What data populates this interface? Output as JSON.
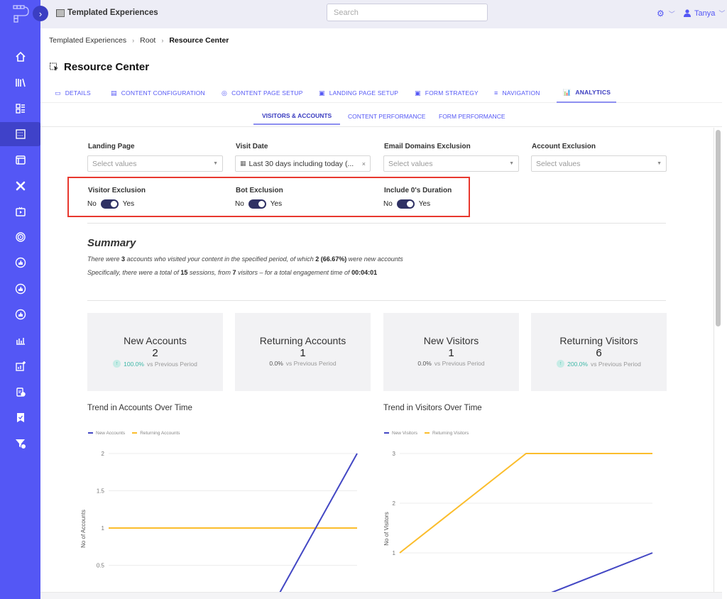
{
  "colors": {
    "accent": "#5457f5",
    "sidebar": "#5457f5",
    "toggle_on": "#2f3164",
    "highlight": "#e8382e",
    "series_blue": "#4347c4",
    "series_yellow": "#fbbd2c",
    "positive": "#3cb7a6"
  },
  "topbar": {
    "app_title": "Templated Experiences",
    "search_placeholder": "Search",
    "settings_icon": "gear-icon",
    "user_name": "Tanya"
  },
  "sidebar": {
    "items": [
      {
        "icon": "home-icon"
      },
      {
        "icon": "library-icon"
      },
      {
        "icon": "layout-grid-icon"
      },
      {
        "icon": "templated-experiences-icon",
        "active": true
      },
      {
        "icon": "browser-window-icon"
      },
      {
        "icon": "tools-icon"
      },
      {
        "icon": "video-icon"
      },
      {
        "icon": "target-icon"
      },
      {
        "icon": "thumbs-up-icon"
      },
      {
        "icon": "thumbs-up-icon"
      },
      {
        "icon": "thumbs-up-icon"
      },
      {
        "icon": "bar-chart-icon"
      },
      {
        "icon": "chart-add-icon"
      },
      {
        "icon": "clipboard-clock-icon"
      },
      {
        "icon": "bookmark-check-icon"
      },
      {
        "icon": "filter-dollar-icon"
      }
    ]
  },
  "breadcrumb": [
    "Templated Experiences",
    "Root",
    "Resource Center"
  ],
  "page_title": "Resource Center",
  "tabs": [
    {
      "label": "DETAILS",
      "icon": "image-icon"
    },
    {
      "label": "CONTENT CONFIGURATION",
      "icon": "document-icon"
    },
    {
      "label": "CONTENT PAGE SETUP",
      "icon": "palette-icon"
    },
    {
      "label": "LANDING PAGE SETUP",
      "icon": "page-icon"
    },
    {
      "label": "FORM STRATEGY",
      "icon": "form-icon"
    },
    {
      "label": "NAVIGATION",
      "icon": "menu-icon"
    },
    {
      "label": "ANALYTICS",
      "icon": "analytics-icon",
      "active": true
    }
  ],
  "subtabs": [
    {
      "label": "VISITORS & ACCOUNTS",
      "active": true
    },
    {
      "label": "CONTENT PERFORMANCE"
    },
    {
      "label": "FORM PERFORMANCE"
    }
  ],
  "filters": {
    "landing_page": {
      "label": "Landing Page",
      "placeholder": "Select values"
    },
    "visit_date": {
      "label": "Visit Date",
      "value": "Last 30 days including today (..."
    },
    "email_domains": {
      "label": "Email Domains Exclusion",
      "placeholder": "Select values"
    },
    "account_exclusion": {
      "label": "Account Exclusion",
      "placeholder": "Select values"
    }
  },
  "toggles": [
    {
      "label": "Visitor Exclusion",
      "off_label": "No",
      "on_label": "Yes",
      "value": true
    },
    {
      "label": "Bot Exclusion",
      "off_label": "No",
      "on_label": "Yes",
      "value": true
    },
    {
      "label": "Include 0's Duration",
      "off_label": "No",
      "on_label": "Yes",
      "value": true
    }
  ],
  "summary": {
    "title": "Summary",
    "line1": {
      "a": "There were ",
      "accounts": "3",
      "b": " accounts who visited your content in the specified period, of which ",
      "new": "2",
      "pct": " (66.67%)",
      "c": " were new accounts"
    },
    "line2": {
      "a": "Specifically, there were a total of ",
      "sessions": "15",
      "b": " sessions, from ",
      "visitors": "7",
      "c": "  visitors – for a total engagement time of ",
      "time": "00:04:01"
    }
  },
  "kpis": [
    {
      "title": "New Accounts",
      "value": "2",
      "change": "100.0%",
      "trend": "up",
      "suffix": "vs Previous Period"
    },
    {
      "title": "Returning Accounts",
      "value": "1",
      "change": "0.0%",
      "trend": "flat",
      "suffix": "vs Previous Period"
    },
    {
      "title": "New Visitors",
      "value": "1",
      "change": "0.0%",
      "trend": "flat",
      "suffix": "vs Previous Period"
    },
    {
      "title": "Returning Visitors",
      "value": "6",
      "change": "200.0%",
      "trend": "up",
      "suffix": "vs Previous Period"
    }
  ],
  "chart_data": [
    {
      "type": "line",
      "title": "Trend in Accounts Over Time",
      "ylabel": "No of Accounts",
      "xlabel": "",
      "yticks": [
        "0.5",
        "1",
        "1.5",
        "2"
      ],
      "ylim": [
        0,
        2
      ],
      "x": [
        0,
        1,
        2,
        3
      ],
      "legend": "top-left",
      "grid": true,
      "series": [
        {
          "name": "New Accounts",
          "color": "#4347c4",
          "values": [
            0,
            0,
            0,
            2
          ]
        },
        {
          "name": "Returning Accounts",
          "color": "#fbbd2c",
          "values": [
            1,
            1,
            1,
            1
          ]
        }
      ]
    },
    {
      "type": "line",
      "title": "Trend in Visitors Over Time",
      "ylabel": "No of Visitors",
      "xlabel": "",
      "yticks": [
        "1",
        "2",
        "3"
      ],
      "ylim": [
        0,
        3
      ],
      "x": [
        0,
        1,
        2
      ],
      "legend": "top-left",
      "grid": true,
      "series": [
        {
          "name": "New Visitors",
          "color": "#4347c4",
          "values": [
            0,
            0,
            1
          ]
        },
        {
          "name": "Returning Visitors",
          "color": "#fbbd2c",
          "values": [
            1,
            3,
            3
          ]
        }
      ]
    }
  ]
}
